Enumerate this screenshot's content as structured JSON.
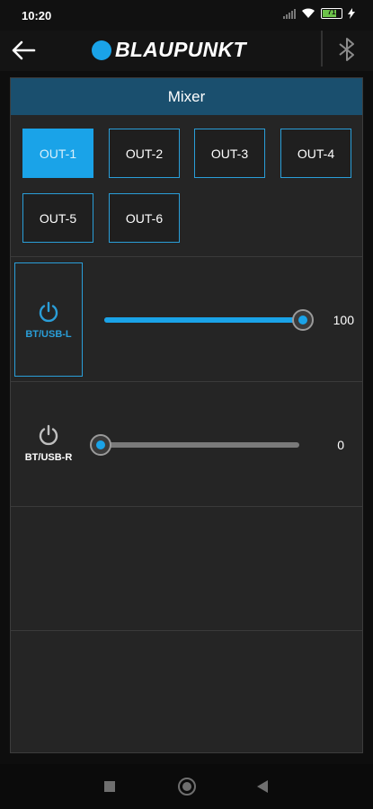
{
  "status_bar": {
    "time": "10:20",
    "battery_level": "71"
  },
  "app_bar": {
    "brand": "BLAUPUNKT",
    "accent_color": "#1aa3e8"
  },
  "mixer": {
    "title": "Mixer",
    "outputs": [
      {
        "label": "OUT-1",
        "active": true
      },
      {
        "label": "OUT-2",
        "active": false
      },
      {
        "label": "OUT-3",
        "active": false
      },
      {
        "label": "OUT-4",
        "active": false
      },
      {
        "label": "OUT-5",
        "active": false
      },
      {
        "label": "OUT-6",
        "active": false
      }
    ],
    "channels": [
      {
        "label": "BT/USB-L",
        "value": "100",
        "level": 1.0,
        "selected": true
      },
      {
        "label": "BT/USB-R",
        "value": "0",
        "level": 0.0,
        "selected": false
      }
    ]
  }
}
